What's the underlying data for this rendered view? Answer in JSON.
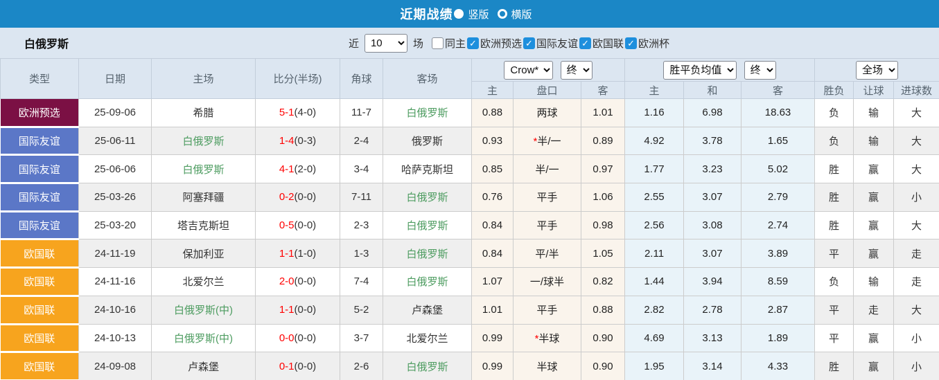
{
  "colors": {
    "titlebar_bg": "#1b87c6",
    "panel_bg": "#dce6f1",
    "stripe_bg": "#efefef",
    "odds_bg": "#faf4ec",
    "avg_bg": "#e9f3f9",
    "team_green": "#4d9c60",
    "score_red": "#ff0000",
    "result_red": "#e84b3f",
    "result_green": "#6d9b6d",
    "result_blue": "#4646d0",
    "type_badges": {
      "qual": "#7b1044",
      "friendly": "#5b77c7",
      "nations": "#f7a41e"
    }
  },
  "titlebar": {
    "title": "近期战绩",
    "radio_vertical": "竖版",
    "radio_horizontal": "横版",
    "selected": "竖版"
  },
  "filters": {
    "team": "白俄罗斯",
    "recent_label": "近",
    "recent_value": "10",
    "matches_label": "场",
    "checkboxes": [
      {
        "label": "同主",
        "checked": false
      },
      {
        "label": "欧洲预选",
        "checked": true
      },
      {
        "label": "国际友谊",
        "checked": true
      },
      {
        "label": "欧国联",
        "checked": true
      },
      {
        "label": "欧洲杯",
        "checked": true
      }
    ]
  },
  "header": {
    "type": "类型",
    "date": "日期",
    "home": "主场",
    "score": "比分(半场)",
    "corner": "角球",
    "away": "客场",
    "odds_company": "Crow*",
    "odds_time": "终",
    "avg_label": "胜平负均值",
    "avg_time": "终",
    "fulltime": "全场",
    "sub": [
      "主",
      "盘口",
      "客",
      "主",
      "和",
      "客",
      "胜负",
      "让球",
      "进球数"
    ]
  },
  "rows": [
    {
      "type": "欧洲预选",
      "type_key": "qual",
      "date": "25-09-06",
      "home": "希腊",
      "home_green": false,
      "score": "5-1",
      "half": "(4-0)",
      "corners": "11-7",
      "away": "白俄罗斯",
      "away_green": true,
      "odds": [
        "0.88",
        "两球",
        "1.01"
      ],
      "hcp_star": false,
      "avg": [
        "1.16",
        "6.98",
        "18.63"
      ],
      "results": [
        [
          "负",
          "green"
        ],
        [
          "输",
          "green"
        ],
        [
          "大",
          "red"
        ]
      ]
    },
    {
      "type": "国际友谊",
      "type_key": "friendly",
      "date": "25-06-11",
      "home": "白俄罗斯",
      "home_green": true,
      "score": "1-4",
      "half": "(0-3)",
      "corners": "2-4",
      "away": "俄罗斯",
      "away_green": false,
      "odds": [
        "0.93",
        "半/一",
        "0.89"
      ],
      "hcp_star": true,
      "avg": [
        "4.92",
        "3.78",
        "1.65"
      ],
      "results": [
        [
          "负",
          "green"
        ],
        [
          "输",
          "green"
        ],
        [
          "大",
          "red"
        ]
      ]
    },
    {
      "type": "国际友谊",
      "type_key": "friendly",
      "date": "25-06-06",
      "home": "白俄罗斯",
      "home_green": true,
      "score": "4-1",
      "half": "(2-0)",
      "corners": "3-4",
      "away": "哈萨克斯坦",
      "away_green": false,
      "odds": [
        "0.85",
        "半/一",
        "0.97"
      ],
      "hcp_star": false,
      "avg": [
        "1.77",
        "3.23",
        "5.02"
      ],
      "results": [
        [
          "胜",
          "red"
        ],
        [
          "赢",
          "red"
        ],
        [
          "大",
          "red"
        ]
      ]
    },
    {
      "type": "国际友谊",
      "type_key": "friendly",
      "date": "25-03-26",
      "home": "阿塞拜疆",
      "home_green": false,
      "score": "0-2",
      "half": "(0-0)",
      "corners": "7-11",
      "away": "白俄罗斯",
      "away_green": true,
      "odds": [
        "0.76",
        "平手",
        "1.06"
      ],
      "hcp_star": false,
      "avg": [
        "2.55",
        "3.07",
        "2.79"
      ],
      "results": [
        [
          "胜",
          "red"
        ],
        [
          "赢",
          "red"
        ],
        [
          "小",
          "green"
        ]
      ]
    },
    {
      "type": "国际友谊",
      "type_key": "friendly",
      "date": "25-03-20",
      "home": "塔吉克斯坦",
      "home_green": false,
      "score": "0-5",
      "half": "(0-0)",
      "corners": "2-3",
      "away": "白俄罗斯",
      "away_green": true,
      "odds": [
        "0.84",
        "平手",
        "0.98"
      ],
      "hcp_star": false,
      "avg": [
        "2.56",
        "3.08",
        "2.74"
      ],
      "results": [
        [
          "胜",
          "red"
        ],
        [
          "赢",
          "red"
        ],
        [
          "大",
          "red"
        ]
      ]
    },
    {
      "type": "欧国联",
      "type_key": "nations",
      "date": "24-11-19",
      "home": "保加利亚",
      "home_green": false,
      "score": "1-1",
      "half": "(1-0)",
      "corners": "1-3",
      "away": "白俄罗斯",
      "away_green": true,
      "odds": [
        "0.84",
        "平/半",
        "1.05"
      ],
      "hcp_star": false,
      "avg": [
        "2.11",
        "3.07",
        "3.89"
      ],
      "results": [
        [
          "平",
          "blue"
        ],
        [
          "赢",
          "red"
        ],
        [
          "走",
          "blue"
        ]
      ]
    },
    {
      "type": "欧国联",
      "type_key": "nations",
      "date": "24-11-16",
      "home": "北爱尔兰",
      "home_green": false,
      "score": "2-0",
      "half": "(0-0)",
      "corners": "7-4",
      "away": "白俄罗斯",
      "away_green": true,
      "odds": [
        "1.07",
        "一/球半",
        "0.82"
      ],
      "hcp_star": false,
      "avg": [
        "1.44",
        "3.94",
        "8.59"
      ],
      "results": [
        [
          "负",
          "green"
        ],
        [
          "输",
          "green"
        ],
        [
          "走",
          "blue"
        ]
      ]
    },
    {
      "type": "欧国联",
      "type_key": "nations",
      "date": "24-10-16",
      "home": "白俄罗斯(中)",
      "home_green": true,
      "score": "1-1",
      "half": "(0-0)",
      "corners": "5-2",
      "away": "卢森堡",
      "away_green": false,
      "odds": [
        "1.01",
        "平手",
        "0.88"
      ],
      "hcp_star": false,
      "avg": [
        "2.82",
        "2.78",
        "2.87"
      ],
      "results": [
        [
          "平",
          "blue"
        ],
        [
          "走",
          "blue"
        ],
        [
          "大",
          "red"
        ]
      ]
    },
    {
      "type": "欧国联",
      "type_key": "nations",
      "date": "24-10-13",
      "home": "白俄罗斯(中)",
      "home_green": true,
      "score": "0-0",
      "half": "(0-0)",
      "corners": "3-7",
      "away": "北爱尔兰",
      "away_green": false,
      "odds": [
        "0.99",
        "半球",
        "0.90"
      ],
      "hcp_star": true,
      "avg": [
        "4.69",
        "3.13",
        "1.89"
      ],
      "results": [
        [
          "平",
          "blue"
        ],
        [
          "赢",
          "red"
        ],
        [
          "小",
          "green"
        ]
      ]
    },
    {
      "type": "欧国联",
      "type_key": "nations",
      "date": "24-09-08",
      "home": "卢森堡",
      "home_green": false,
      "score": "0-1",
      "half": "(0-0)",
      "corners": "2-6",
      "away": "白俄罗斯",
      "away_green": true,
      "odds": [
        "0.99",
        "半球",
        "0.90"
      ],
      "hcp_star": false,
      "avg": [
        "1.95",
        "3.14",
        "4.33"
      ],
      "results": [
        [
          "胜",
          "red"
        ],
        [
          "赢",
          "red"
        ],
        [
          "小",
          "green"
        ]
      ]
    }
  ]
}
